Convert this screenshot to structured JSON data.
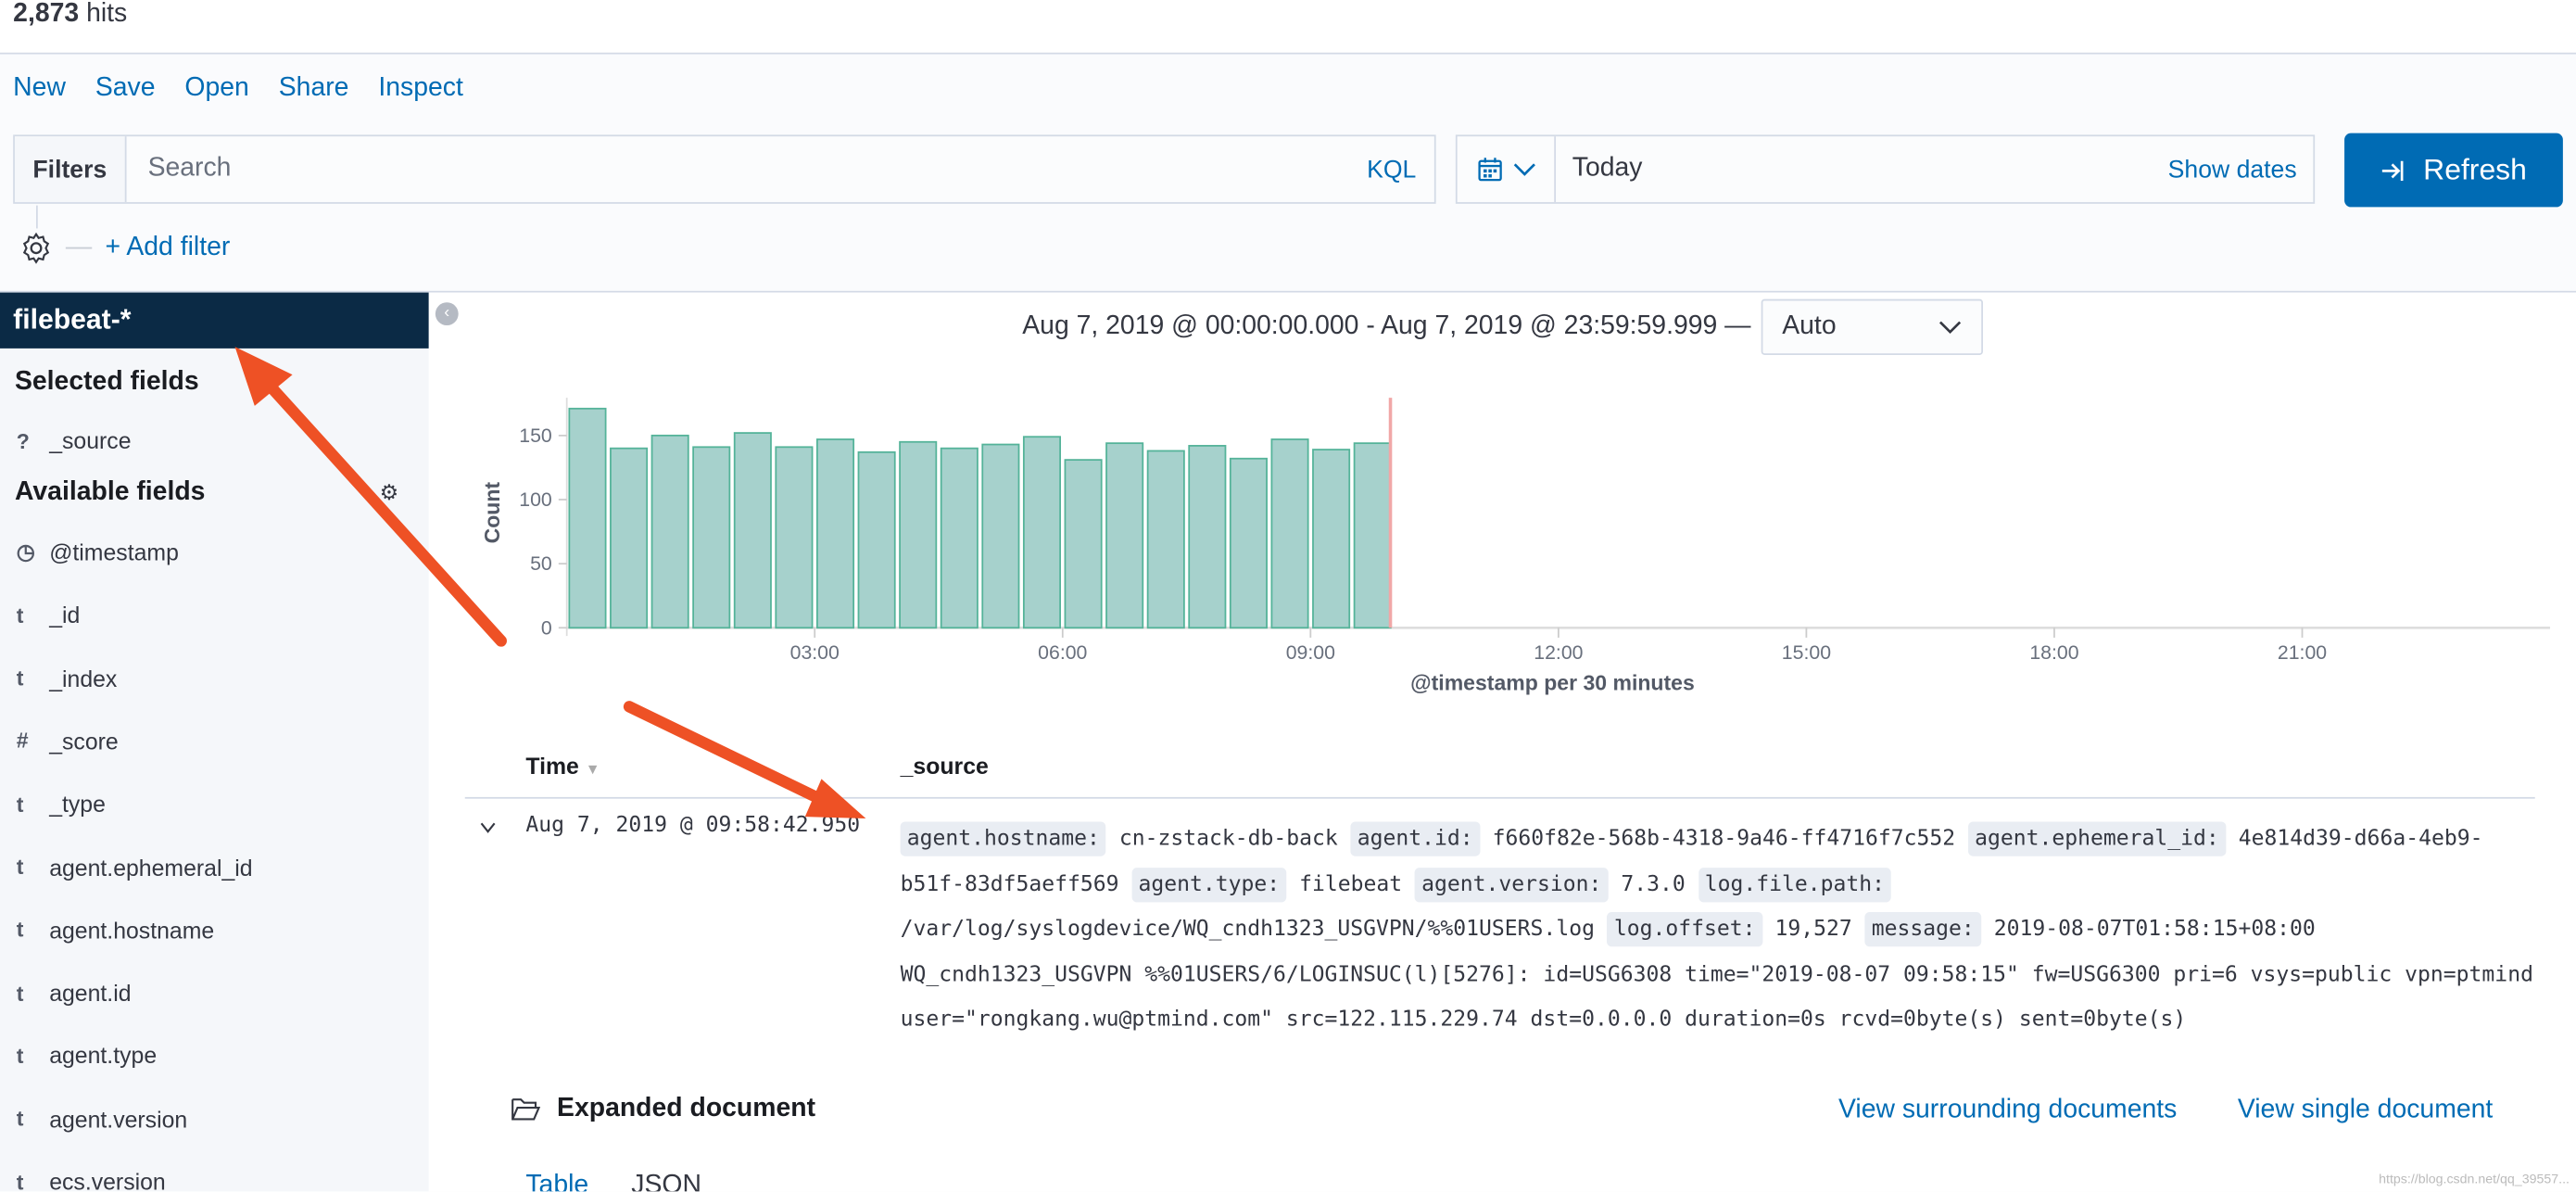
{
  "hits": {
    "count": "2,873",
    "label": "hits"
  },
  "menu": [
    "New",
    "Save",
    "Open",
    "Share",
    "Inspect"
  ],
  "filters": {
    "label": "Filters",
    "search_placeholder": "Search",
    "kql": "KQL"
  },
  "datepicker": {
    "value": "Today",
    "show_dates": "Show dates"
  },
  "refresh": {
    "label": "Refresh"
  },
  "add_filter": "+ Add filter",
  "sidebar": {
    "index_pattern": "filebeat-*",
    "selected_title": "Selected fields",
    "selected": [
      {
        "type": "?",
        "name": "_source"
      }
    ],
    "available_title": "Available fields",
    "available": [
      {
        "type": "clock",
        "name": "@timestamp"
      },
      {
        "type": "t",
        "name": "_id"
      },
      {
        "type": "t",
        "name": "_index"
      },
      {
        "type": "#",
        "name": "_score"
      },
      {
        "type": "t",
        "name": "_type"
      },
      {
        "type": "t",
        "name": "agent.ephemeral_id"
      },
      {
        "type": "t",
        "name": "agent.hostname"
      },
      {
        "type": "t",
        "name": "agent.id"
      },
      {
        "type": "t",
        "name": "agent.type"
      },
      {
        "type": "t",
        "name": "agent.version"
      },
      {
        "type": "t",
        "name": "ecs.version"
      }
    ]
  },
  "range": {
    "text": "Aug 7, 2019 @ 00:00:00.000 - Aug 7, 2019 @ 23:59:59.999 —",
    "interval": "Auto"
  },
  "chart_data": {
    "type": "bar",
    "xlabel": "@timestamp per 30 minutes",
    "ylabel": "Count",
    "bucket_hours": 0.5,
    "x_range_hours": [
      0,
      24
    ],
    "xticks": [
      "03:00",
      "06:00",
      "09:00",
      "12:00",
      "15:00",
      "18:00",
      "21:00"
    ],
    "yticks": [
      0,
      50,
      100,
      150
    ],
    "ylim": [
      0,
      180
    ],
    "categories": [
      "00:00",
      "00:30",
      "01:00",
      "01:30",
      "02:00",
      "02:30",
      "03:00",
      "03:30",
      "04:00",
      "04:30",
      "05:00",
      "05:30",
      "06:00",
      "06:30",
      "07:00",
      "07:30",
      "08:00",
      "08:30",
      "09:00",
      "09:30"
    ],
    "values": [
      171,
      140,
      150,
      141,
      152,
      141,
      147,
      137,
      145,
      140,
      143,
      149,
      131,
      144,
      138,
      142,
      132,
      147,
      139,
      144
    ],
    "now_marker": "09:58",
    "bar_color": "#a6d1cc",
    "bar_border": "#54b399",
    "now_color": "#f1a7a7"
  },
  "table": {
    "headers": [
      "Time",
      "_source"
    ],
    "row": {
      "time": "Aug 7, 2019 @ 09:58:42.950",
      "source": [
        {
          "k": "agent.hostname:",
          "v": "cn-zstack-db-back"
        },
        {
          "k": "agent.id:",
          "v": "f660f82e-568b-4318-9a46-ff4716f7c552"
        },
        {
          "k": "agent.ephemeral_id:",
          "v": "4e814d39-d66a-4eb9-b51f-83df5aeff569"
        },
        {
          "k": "agent.type:",
          "v": "filebeat"
        },
        {
          "k": "agent.version:",
          "v": "7.3.0"
        },
        {
          "k": "log.file.path:",
          "v": "/var/log/syslogdevice/WQ_cndh1323_USGVPN/%%01USERS.log"
        },
        {
          "k": "log.offset:",
          "v": "19,527"
        },
        {
          "k": "message:",
          "v": "2019-08-07T01:58:15+08:00 WQ_cndh1323_USGVPN %%01USERS/6/LOGINSUC(l)[5276]: id=USG6308 time=\"2019-08-07 09:58:15\" fw=USG6300 pri=6 vsys=public vpn=ptmind user=\"rongkang.wu@ptmind.com\" src=122.115.229.74 dst=0.0.0.0 duration=0s rcvd=0byte(s) sent=0byte(s)"
        }
      ]
    }
  },
  "expanded": {
    "title": "Expanded document",
    "surrounding": "View surrounding documents",
    "single": "View single document",
    "tabs": [
      "Table",
      "JSON"
    ]
  },
  "watermark": "https://blog.csdn.net/qq_39557...",
  "colors": {
    "accent": "#006bb4",
    "sidebar_header": "#0b2a45",
    "annotation_arrow": "#ee5125"
  }
}
